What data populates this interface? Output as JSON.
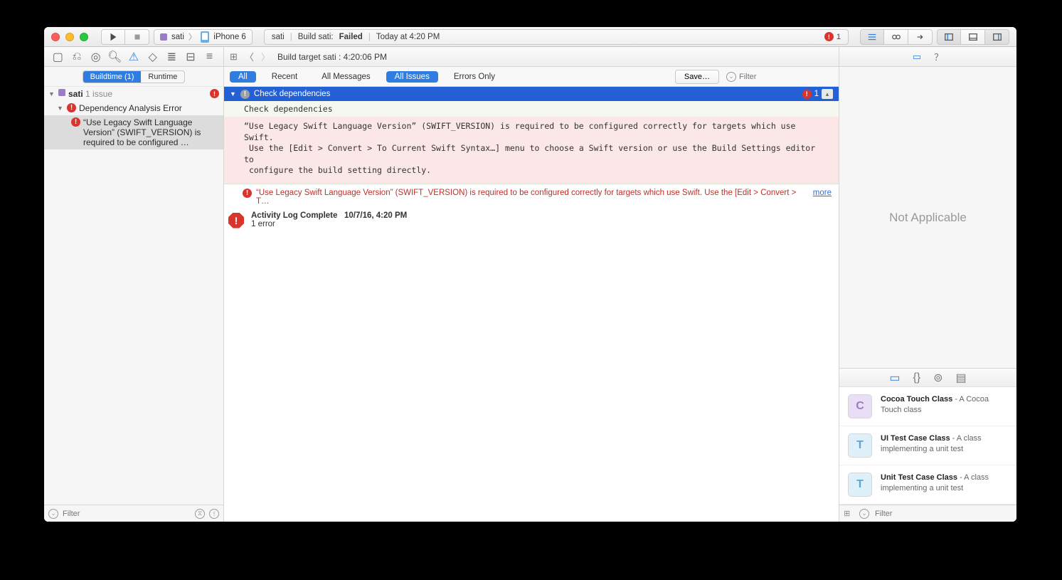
{
  "toolbar": {
    "scheme_name": "sati",
    "device": "iPhone 6",
    "activity_project": "sati",
    "activity_task": "Build sati:",
    "activity_status": "Failed",
    "activity_time": "Today at 4:20 PM",
    "activity_error_count": "1"
  },
  "navigator": {
    "segments": {
      "buildtime": "Buildtime (1)",
      "runtime": "Runtime"
    },
    "root": {
      "name": "sati",
      "issue_text": "1 issue"
    },
    "group": "Dependency Analysis Error",
    "issue_line1": "“Use Legacy Swift Language",
    "issue_line2": "Version” (SWIFT_VERSION) is",
    "issue_line3": "required to be configured …",
    "filter_placeholder": "Filter"
  },
  "editor": {
    "jump": "Build target sati : 4:20:06 PM",
    "filters": {
      "all": "All",
      "recent": "Recent",
      "all_messages": "All Messages",
      "all_issues": "All Issues",
      "errors_only": "Errors Only",
      "save": "Save…",
      "filter_placeholder": "Filter"
    },
    "issue_header": "Check dependencies",
    "issue_header_count": "1",
    "code_header": "Check dependencies",
    "code_body": "“Use Legacy Swift Language Version” (SWIFT_VERSION) is required to be configured correctly for targets which use Swift.\n Use the [Edit > Convert > To Current Swift Syntax…] menu to choose a Swift version or use the Build Settings editor to\n configure the build setting directly.",
    "inline_error": "“Use Legacy Swift Language Version” (SWIFT_VERSION) is required to be configured correctly for targets which use Swift. Use the [Edit > Convert > T…",
    "more": "more",
    "log_title": "Activity Log Complete",
    "log_time": "10/7/16, 4:20 PM",
    "log_sub": "1 error"
  },
  "inspector": {
    "placeholder": "Not Applicable",
    "lib": [
      {
        "icon": "C",
        "cls": "c",
        "name": "Cocoa Touch Class",
        "desc": " - A Cocoa Touch class"
      },
      {
        "icon": "T",
        "cls": "t",
        "name": "UI Test Case Class",
        "desc": " - A class implementing a unit test"
      },
      {
        "icon": "T",
        "cls": "t",
        "name": "Unit Test Case Class",
        "desc": " - A class implementing a unit test"
      }
    ],
    "filter_placeholder": "Filter"
  }
}
